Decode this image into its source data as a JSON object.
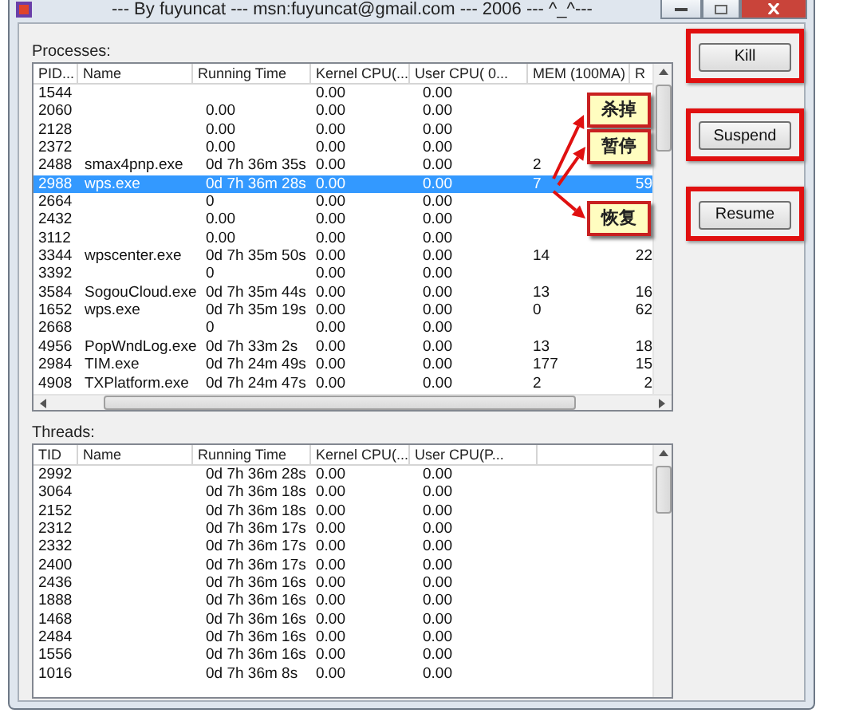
{
  "window": {
    "title": "--- By fuyuncat --- msn:fuyuncat@gmail.com --- 2006 --- ^_^---"
  },
  "processes": {
    "label": "Processes:",
    "columns": [
      "PID...",
      "Name",
      "Running Time",
      "Kernel CPU(...",
      "User CPU( 0...",
      "MEM (100MA)",
      "R"
    ],
    "rows": [
      {
        "cells": [
          "1544",
          "",
          "",
          "0.00",
          "0.00",
          "",
          ""
        ],
        "selected": false
      },
      {
        "cells": [
          "2060",
          "",
          "0.00",
          "0.00",
          "0.00",
          "",
          ""
        ],
        "selected": false
      },
      {
        "cells": [
          "2128",
          "",
          "0.00",
          "0.00",
          "0.00",
          "",
          ""
        ],
        "selected": false
      },
      {
        "cells": [
          "2372",
          "",
          "0.00",
          "0.00",
          "0.00",
          "",
          ""
        ],
        "selected": false
      },
      {
        "cells": [
          "2488",
          "smax4pnp.exe",
          "0d 7h 36m 35s",
          "0.00",
          "0.00",
          "2",
          ""
        ],
        "selected": false
      },
      {
        "cells": [
          "2988",
          "wps.exe",
          "0d 7h 36m 28s",
          "0.00",
          "0.00",
          "7",
          "59"
        ],
        "selected": true
      },
      {
        "cells": [
          "2664",
          "",
          "0",
          "0.00",
          "0.00",
          "",
          ""
        ],
        "selected": false
      },
      {
        "cells": [
          "2432",
          "",
          "0.00",
          "0.00",
          "0.00",
          "",
          ""
        ],
        "selected": false
      },
      {
        "cells": [
          "3112",
          "",
          "0.00",
          "0.00",
          "0.00",
          "",
          ""
        ],
        "selected": false
      },
      {
        "cells": [
          "3344",
          "wpscenter.exe",
          "0d 7h 35m 50s",
          "0.00",
          "0.00",
          "14",
          "22"
        ],
        "selected": false
      },
      {
        "cells": [
          "3392",
          "",
          "0",
          "0.00",
          "0.00",
          "",
          ""
        ],
        "selected": false
      },
      {
        "cells": [
          "3584",
          "SogouCloud.exe",
          "0d 7h 35m 44s",
          "0.00",
          "0.00",
          "13",
          "16"
        ],
        "selected": false
      },
      {
        "cells": [
          "1652",
          "wps.exe",
          "0d 7h 35m 19s",
          "0.00",
          "0.00",
          "0",
          "62"
        ],
        "selected": false
      },
      {
        "cells": [
          "2668",
          "",
          "0",
          "0.00",
          "0.00",
          "",
          ""
        ],
        "selected": false
      },
      {
        "cells": [
          "4956",
          "PopWndLog.exe",
          "0d 7h 33m 2s",
          "0.00",
          "0.00",
          "13",
          "18"
        ],
        "selected": false
      },
      {
        "cells": [
          "2984",
          "TIM.exe",
          "0d 7h 24m 49s",
          "0.00",
          "0.00",
          "177",
          "15"
        ],
        "selected": false
      },
      {
        "cells": [
          "4908",
          "TXPlatform.exe",
          "0d 7h 24m 47s",
          "0.00",
          "0.00",
          "2",
          "2"
        ],
        "selected": false
      }
    ]
  },
  "threads": {
    "label": "Threads:",
    "columns": [
      "TID",
      "Name",
      "Running Time",
      "Kernel CPU(...",
      "User CPU(P..."
    ],
    "rows": [
      {
        "cells": [
          "2992",
          "",
          "0d 7h 36m 28s",
          "0.00",
          "0.00"
        ]
      },
      {
        "cells": [
          "3064",
          "",
          "0d 7h 36m 18s",
          "0.00",
          "0.00"
        ]
      },
      {
        "cells": [
          "2152",
          "",
          "0d 7h 36m 18s",
          "0.00",
          "0.00"
        ]
      },
      {
        "cells": [
          "2312",
          "",
          "0d 7h 36m 17s",
          "0.00",
          "0.00"
        ]
      },
      {
        "cells": [
          "2332",
          "",
          "0d 7h 36m 17s",
          "0.00",
          "0.00"
        ]
      },
      {
        "cells": [
          "2400",
          "",
          "0d 7h 36m 17s",
          "0.00",
          "0.00"
        ]
      },
      {
        "cells": [
          "2436",
          "",
          "0d 7h 36m 16s",
          "0.00",
          "0.00"
        ]
      },
      {
        "cells": [
          "1888",
          "",
          "0d 7h 36m 16s",
          "0.00",
          "0.00"
        ]
      },
      {
        "cells": [
          "1468",
          "",
          "0d 7h 36m 16s",
          "0.00",
          "0.00"
        ]
      },
      {
        "cells": [
          "2484",
          "",
          "0d 7h 36m 16s",
          "0.00",
          "0.00"
        ]
      },
      {
        "cells": [
          "1556",
          "",
          "0d 7h 36m 16s",
          "0.00",
          "0.00"
        ]
      },
      {
        "cells": [
          "1016",
          "",
          "0d 7h 36m 8s",
          "0.00",
          "0.00"
        ]
      }
    ]
  },
  "buttons": [
    "Kill",
    "Suspend",
    "Resume"
  ],
  "annotations": [
    "杀掉",
    "暂停",
    "恢复"
  ]
}
